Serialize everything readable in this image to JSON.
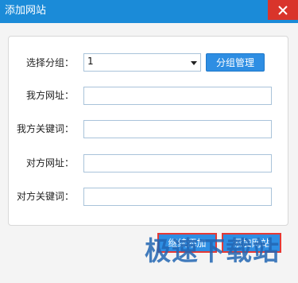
{
  "window": {
    "title": "添加网站",
    "close_icon": "close-icon",
    "colors": {
      "titlebar": "#1b8bd8",
      "close": "#d9342b",
      "button": "#2e8ee3",
      "highlight": "#e53935"
    }
  },
  "form": {
    "group_label": "选择分组：",
    "group_value": "1",
    "manage_group_label": "分组管理",
    "our_url_label": "我方网址：",
    "our_url_value": "",
    "our_keyword_label": "我方关键词：",
    "our_keyword_value": "",
    "their_url_label": "对方网址：",
    "their_url_value": "",
    "their_keyword_label": "对方关键词：",
    "their_keyword_value": ""
  },
  "footer": {
    "continue_label": "继续添加",
    "add_label": "添加网站"
  },
  "watermark": {
    "text": "极速下载站"
  }
}
